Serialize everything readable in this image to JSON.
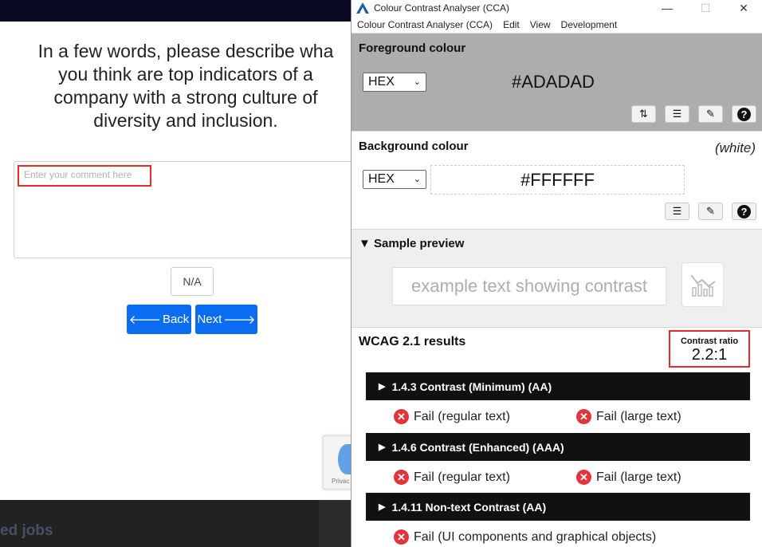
{
  "survey": {
    "question": "In a few words, please describe wha\nyou think are top indicators of a\ncompany with a strong culture of\ndiversity and inclusion.",
    "comment_placeholder": "Enter your comment here",
    "na_label": "N/A",
    "back_label": "Back",
    "next_label": "Next",
    "recaptcha_text": "Privac",
    "footer_text": "ed jobs"
  },
  "cca": {
    "title": "Colour Contrast Analyser (CCA)",
    "window_controls": {
      "minimize": "—",
      "maximize": "☐",
      "close": "✕"
    },
    "menu": [
      "Colour Contrast Analyser (CCA)",
      "Edit",
      "View",
      "Development"
    ],
    "foreground": {
      "title": "Foreground colour",
      "format": "HEX",
      "value": "#ADADAD",
      "color": "#ADADAD"
    },
    "background": {
      "title": "Background colour",
      "name": "(white)",
      "format": "HEX",
      "value": "#FFFFFF",
      "color": "#FFFFFF"
    },
    "preview": {
      "title": "Sample preview",
      "sample_text": "example text showing contrast"
    },
    "wcag": {
      "title": "WCAG 2.1 results",
      "ratio_label": "Contrast ratio",
      "ratio_value": "2.2:1",
      "criteria": [
        {
          "label": "1.4.3 Contrast (Minimum) (AA)",
          "results": [
            "Fail (regular text)",
            "Fail (large text)"
          ]
        },
        {
          "label": "1.4.6 Contrast (Enhanced) (AAA)",
          "results": [
            "Fail (regular text)",
            "Fail (large text)"
          ]
        },
        {
          "label": "1.4.11 Non-text Contrast (AA)",
          "results": [
            "Fail (UI components and graphical objects)"
          ]
        }
      ]
    },
    "colors": {
      "fail": "#E0353C",
      "highlight": "#E52B2B",
      "accent": "#0A6CF0"
    }
  }
}
